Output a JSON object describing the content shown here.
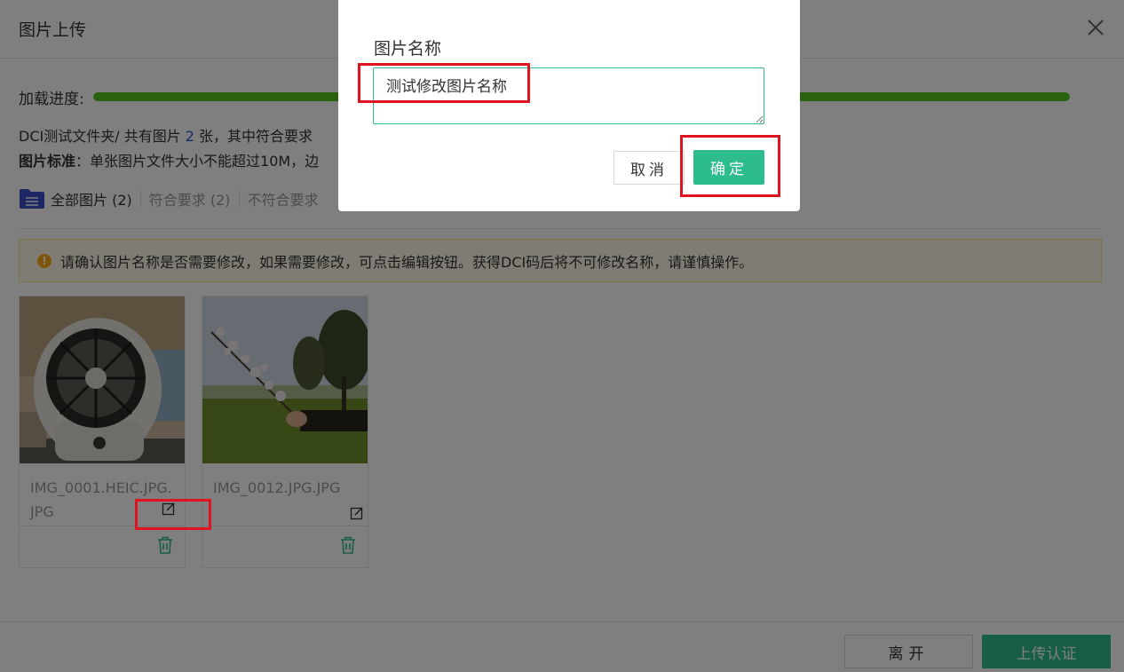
{
  "dialog": {
    "title": "图片上传",
    "progress_label": "加载进度:",
    "progress_value": 1.0,
    "folder_prefix": "DCI测试文件夹/ 共有图片 ",
    "folder_count": "2",
    "folder_suffix": " 张，其中符合要求",
    "standard_bold": "图片标准",
    "standard_text": "：单张图片文件大小不能超过10M，边",
    "tabs": [
      {
        "label": "全部图片 (2)"
      },
      {
        "label": "符合要求 (2)"
      },
      {
        "label": "不符合要求"
      }
    ],
    "notice": "请确认图片名称是否需要修改，如果需要修改，可点击编辑按钮。获得DCI码后将不可修改名称，请谨慎操作。",
    "cards": [
      {
        "name": "IMG_0001.HEIC.JPG.JPG"
      },
      {
        "name": "IMG_0012.JPG.JPG"
      }
    ],
    "leave_label": "离开",
    "upload_label": "上传认证"
  },
  "modal": {
    "label": "图片名称",
    "input_value": "测试修改图片名称",
    "cancel_label": "取消",
    "confirm_label": "确定"
  },
  "colors": {
    "accent": "#2dbc8d",
    "progress": "#52c41a",
    "highlight": "#e0141e",
    "notice_bg": "#fffbe6"
  }
}
